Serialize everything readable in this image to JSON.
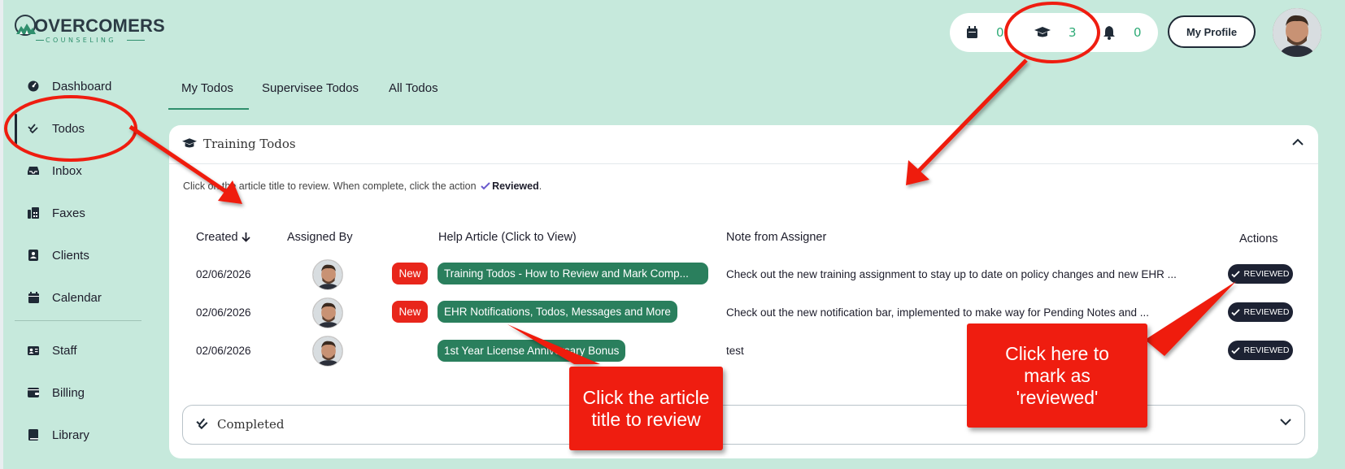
{
  "logo": {
    "text": "OVERCOMERS",
    "sub": "COUNSELING"
  },
  "topbar": {
    "counters": [
      {
        "icon": "calendar-icon",
        "count": "0"
      },
      {
        "icon": "graduation-cap-icon",
        "count": "3"
      },
      {
        "icon": "bell-icon",
        "count": "0"
      }
    ],
    "profile_label": "My Profile"
  },
  "sidebar": {
    "items": [
      {
        "label": "Dashboard",
        "icon": "dashboard-icon"
      },
      {
        "label": "Todos",
        "icon": "check-double-icon",
        "active": true
      },
      {
        "label": "Inbox",
        "icon": "inbox-icon"
      },
      {
        "label": "Faxes",
        "icon": "fax-icon"
      },
      {
        "label": "Clients",
        "icon": "client-card-icon"
      },
      {
        "label": "Calendar",
        "icon": "calendar-icon"
      },
      {
        "label": "Staff",
        "icon": "id-card-icon"
      },
      {
        "label": "Billing",
        "icon": "wallet-icon"
      },
      {
        "label": "Library",
        "icon": "book-icon"
      }
    ]
  },
  "tabs": [
    {
      "label": "My Todos",
      "active": true
    },
    {
      "label": "Supervisee Todos"
    },
    {
      "label": "All Todos"
    }
  ],
  "card": {
    "title": "Training Todos",
    "instruction_pre": "Click on the article title to review. When complete, click the action",
    "instruction_action": "Reviewed",
    "instruction_post": ".",
    "columns": [
      "Created",
      "Assigned By",
      "Help Article (Click to View)",
      "Note from Assigner",
      "Actions"
    ],
    "rows": [
      {
        "date": "02/06/2026",
        "new_badge": "New",
        "article": "Training Todos - How to Review and Mark Comp...",
        "note": "Check out the new training assignment to stay up to date on policy changes and new EHR ...",
        "action": "REVIEWED"
      },
      {
        "date": "02/06/2026",
        "new_badge": "New",
        "article": "EHR Notifications, Todos, Messages and More",
        "note": "Check out the new notification bar, implemented to make way for Pending Notes and ...",
        "action": "REVIEWED"
      },
      {
        "date": "02/06/2026",
        "new_badge": "",
        "article": "1st Year License Anniversary Bonus",
        "note": "test",
        "action": "REVIEWED"
      }
    ],
    "completed_label": "Completed"
  },
  "annotations": {
    "callout_article": "Click the article title to review",
    "callout_reviewed": "Click here to mark as 'reviewed'",
    "color": "#ef1d10"
  },
  "colors": {
    "background": "#c6e9dc",
    "accent_green": "#2a7f5d",
    "count_green": "#2fab77",
    "badge_red": "#e8261b",
    "dark_button": "#1d2233"
  }
}
